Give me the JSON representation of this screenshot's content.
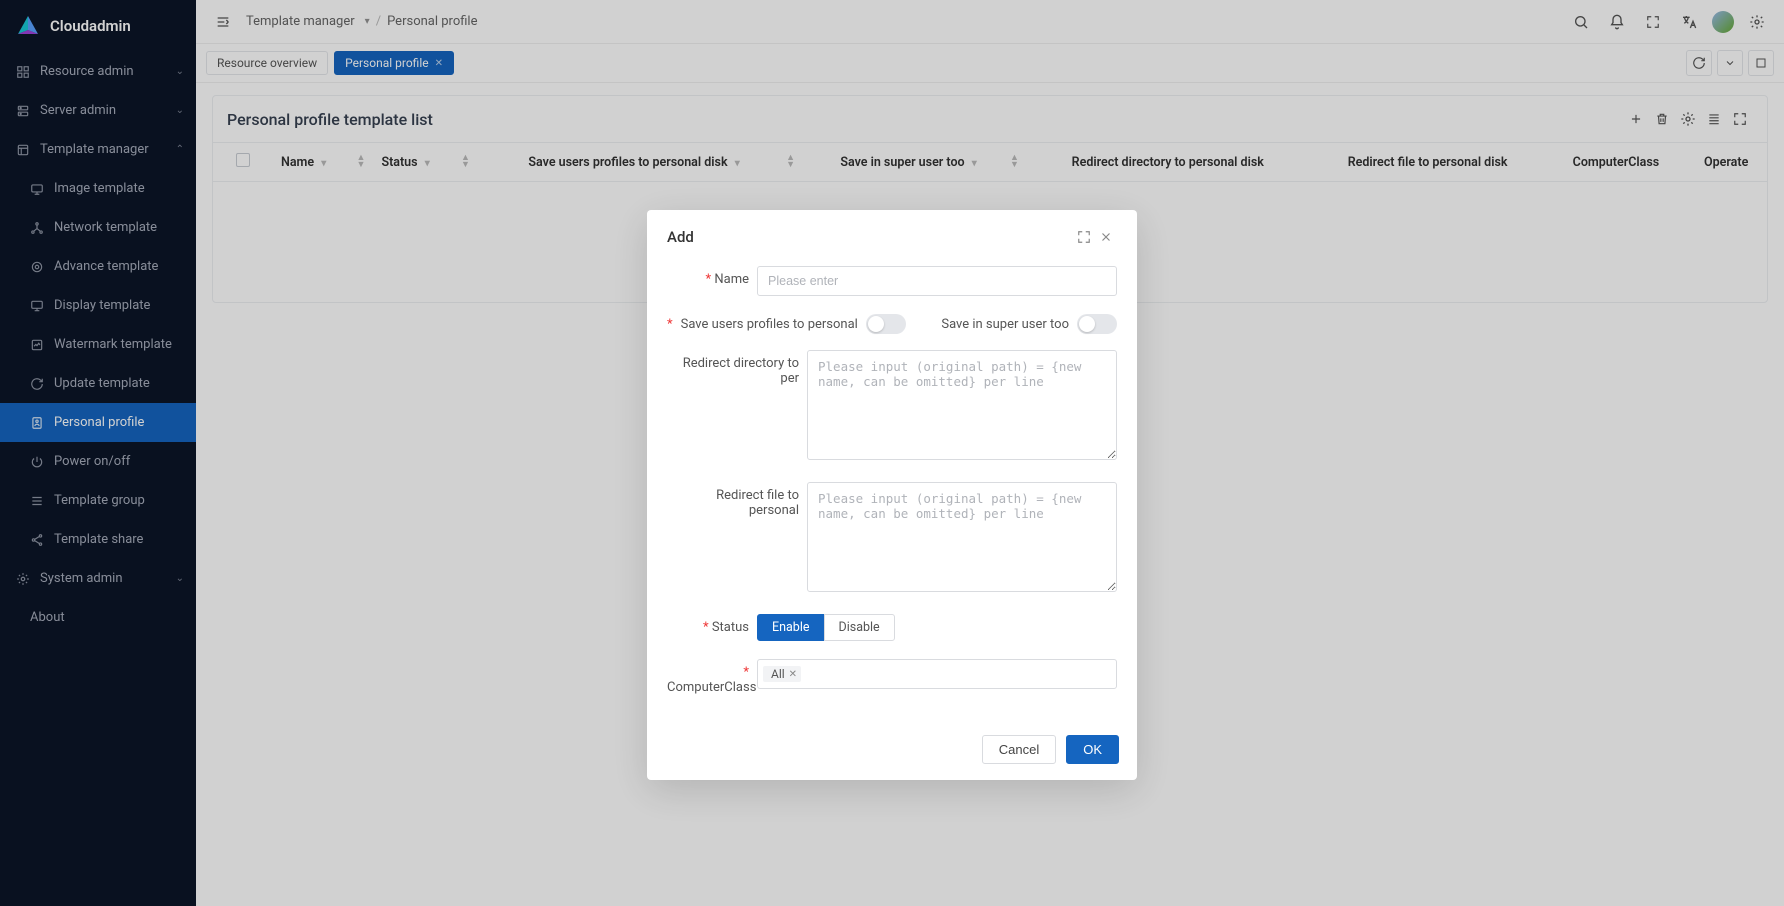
{
  "brand": "Cloudadmin",
  "sidebar": {
    "items": [
      {
        "label": "Resource admin",
        "expandable": true
      },
      {
        "label": "Server admin",
        "expandable": true
      },
      {
        "label": "Template manager",
        "expandable": true,
        "open": true
      },
      {
        "label": "Image template",
        "child": true
      },
      {
        "label": "Network template",
        "child": true
      },
      {
        "label": "Advance template",
        "child": true
      },
      {
        "label": "Display template",
        "child": true
      },
      {
        "label": "Watermark template",
        "child": true
      },
      {
        "label": "Update template",
        "child": true
      },
      {
        "label": "Personal profile",
        "child": true,
        "active": true
      },
      {
        "label": "Power on/off",
        "child": true
      },
      {
        "label": "Template group",
        "child": true
      },
      {
        "label": "Template share",
        "child": true
      },
      {
        "label": "System admin",
        "expandable": true
      },
      {
        "label": "About",
        "child": true
      }
    ]
  },
  "breadcrumb": {
    "root": "Template manager",
    "leaf": "Personal profile"
  },
  "tabs": [
    {
      "label": "Resource overview",
      "active": false
    },
    {
      "label": "Personal profile",
      "active": true,
      "closable": true
    }
  ],
  "panel": {
    "title": "Personal profile template list",
    "columns": [
      "Name",
      "Status",
      "Save users profiles to personal disk",
      "Save in super user too",
      "Redirect directory to personal disk",
      "Redirect file to personal disk",
      "ComputerClass",
      "Operate"
    ]
  },
  "modal": {
    "title": "Add",
    "name_label": "Name",
    "name_placeholder": "Please enter",
    "save_profiles_label": "Save users profiles to personal",
    "save_super_label": "Save in super user too",
    "redirect_dir_label": "Redirect directory to per",
    "redirect_dir_placeholder": "Please input (original path) = {new name, can be omitted} per line",
    "redirect_file_label": "Redirect file to personal",
    "redirect_file_placeholder": "Please input (original path) = {new name, can be omitted} per line",
    "status_label": "Status",
    "status_options": {
      "enable": "Enable",
      "disable": "Disable"
    },
    "class_label": "ComputerClass",
    "class_tag": "All",
    "cancel": "Cancel",
    "ok": "OK"
  }
}
